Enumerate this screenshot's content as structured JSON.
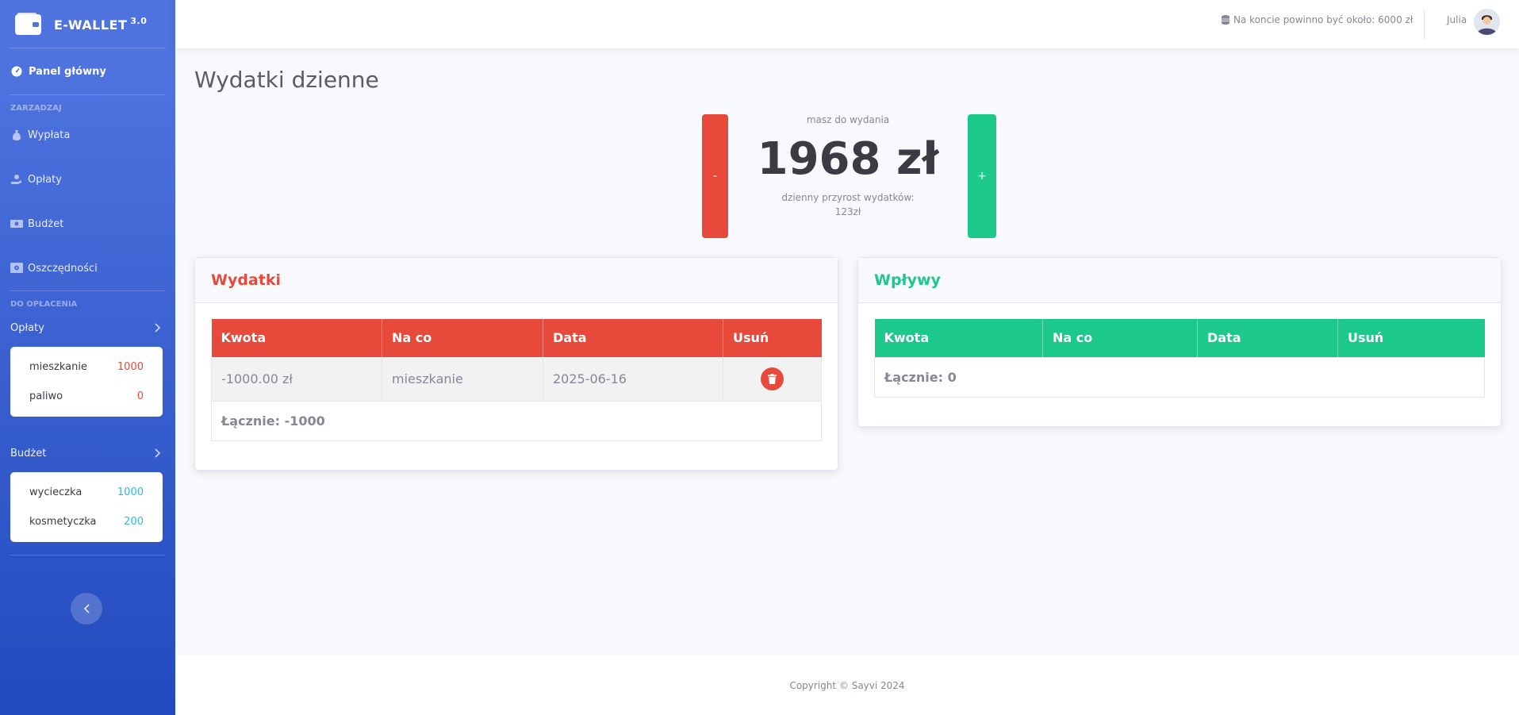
{
  "brand": {
    "name": "E-WALLET",
    "version": "3.0"
  },
  "sidebar": {
    "dashboard": "Panel główny",
    "heading_manage": "ZARZĄDZAJ",
    "items": [
      {
        "label": "Wypłata",
        "icon": "money-bag-icon"
      },
      {
        "label": "Opłaty",
        "icon": "hand-coin-icon"
      },
      {
        "label": "Budżet",
        "icon": "banknote-icon"
      },
      {
        "label": "Oszczędności",
        "icon": "safe-icon"
      }
    ],
    "heading_due": "DO OPŁACENIA",
    "fees": {
      "title": "Opłaty",
      "rows": [
        {
          "name": "mieszkanie",
          "value": "1000"
        },
        {
          "name": "paliwo",
          "value": "0"
        }
      ]
    },
    "budget": {
      "title": "Budżet",
      "rows": [
        {
          "name": "wycieczka",
          "value": "1000"
        },
        {
          "name": "kosmetyczka",
          "value": "200"
        }
      ]
    }
  },
  "topbar": {
    "account_info": "Na koncie powinno być około: 6000 zł",
    "user": "Julia"
  },
  "main": {
    "title": "Wydatki dzienne",
    "to_spend_label": "masz do wydania",
    "amount": "1968 zł",
    "growth_label": "dzienny przyrost wydatków:",
    "growth_value": "123zł",
    "minus": "-",
    "plus": "+"
  },
  "expenses": {
    "title": "Wydatki",
    "columns": [
      "Kwota",
      "Na co",
      "Data",
      "Usuń"
    ],
    "rows": [
      {
        "amount": "-1000.00 zł",
        "for": "mieszkanie",
        "date": "2025-06-16"
      }
    ],
    "total": "Łącznie: -1000"
  },
  "income": {
    "title": "Wpływy",
    "columns": [
      "Kwota",
      "Na co",
      "Data",
      "Usuń"
    ],
    "total": "Łącznie: 0"
  },
  "footer": "Copyright © Sayvi 2024",
  "colors": {
    "primary": "#4e73df",
    "danger": "#e74a3b",
    "success": "#1cc88a",
    "info": "#36b9cc"
  }
}
